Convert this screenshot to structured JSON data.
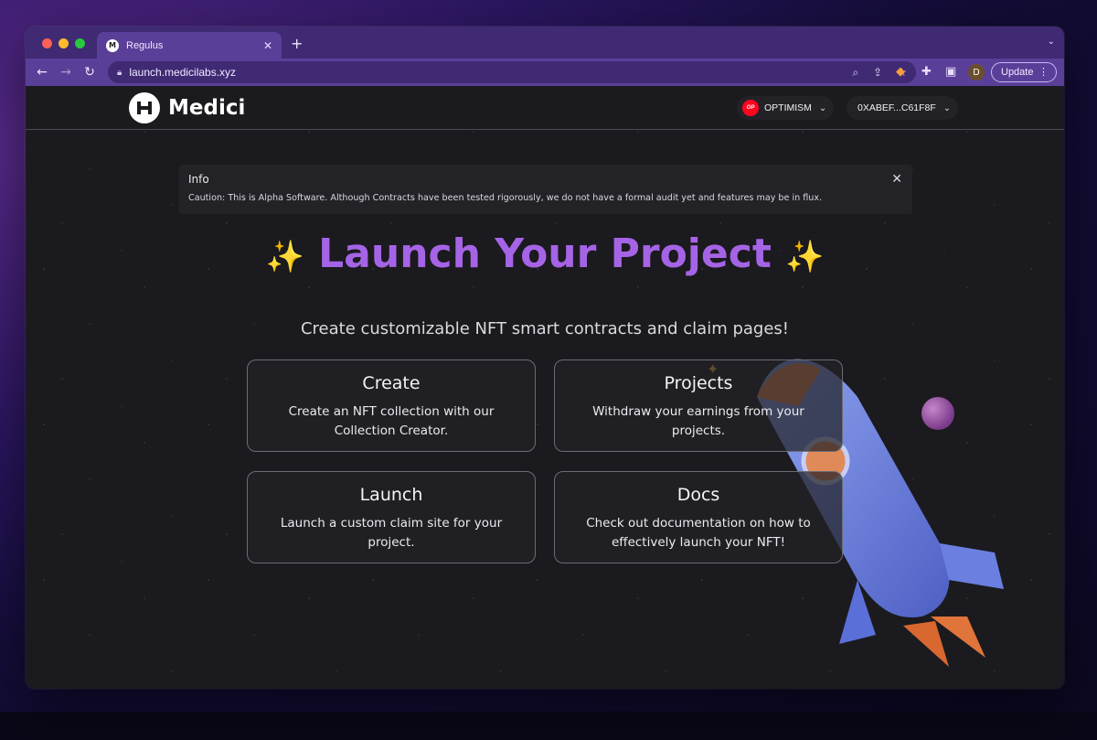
{
  "browser": {
    "tab_title": "Regulus",
    "url": "launch.medicilabs.xyz",
    "update_label": "Update",
    "profile_initial": "D"
  },
  "header": {
    "brand": "Medici",
    "network_label": "OPTIMISM",
    "network_badge": "OP",
    "wallet_label": "0XABEF...C61F8F"
  },
  "info": {
    "title": "Info",
    "message": "Caution: This is Alpha Software. Although Contracts have been tested rigorously, we do not have a formal audit yet and features may be in flux."
  },
  "hero": {
    "sparkle": "✨",
    "title": "Launch Your Project",
    "subtitle": "Create customizable NFT smart contracts and claim pages!"
  },
  "cards": [
    {
      "title": "Create",
      "description": "Create an NFT collection with our Collection Creator."
    },
    {
      "title": "Projects",
      "description": "Withdraw your earnings from your projects."
    },
    {
      "title": "Launch",
      "description": "Launch a custom claim site for your project."
    },
    {
      "title": "Docs",
      "description": "Check out documentation on how to effectively launch your NFT!"
    }
  ],
  "colors": {
    "accent": "#a564e6",
    "browser_chrome": "#5a3f99",
    "page_bg": "#1b1a1e"
  }
}
